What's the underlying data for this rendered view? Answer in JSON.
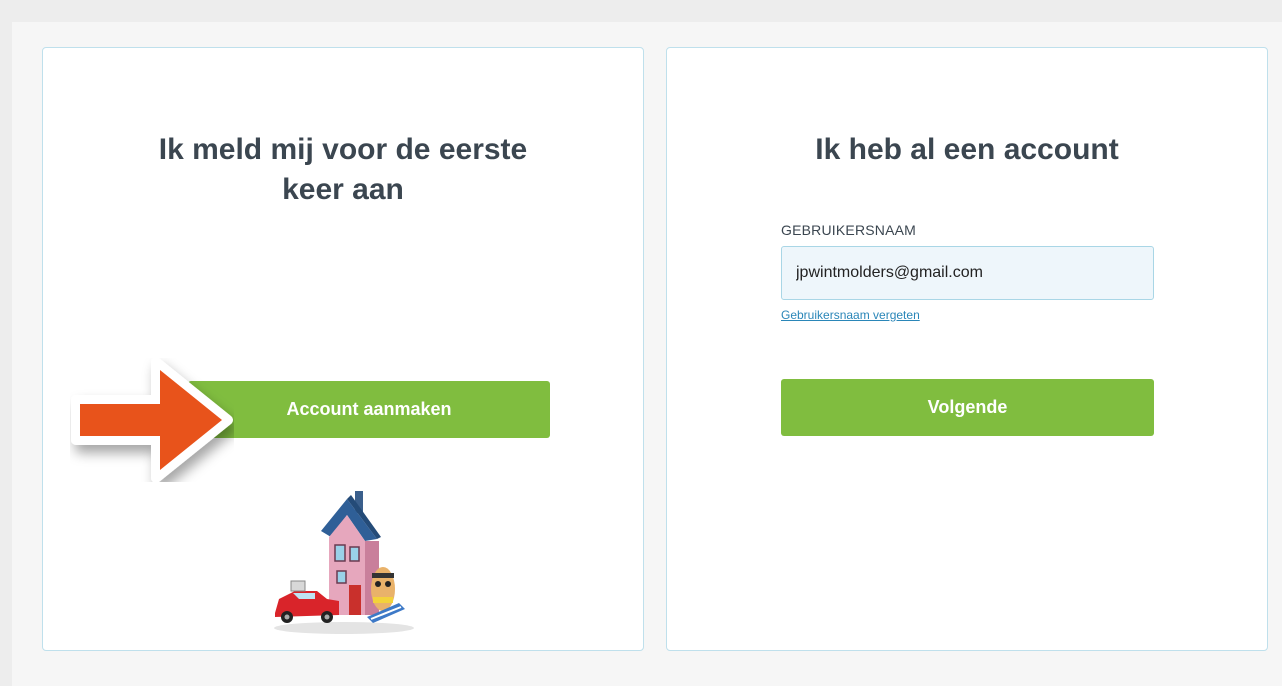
{
  "register": {
    "title": "Ik meld mij voor de eerste keer aan",
    "button_label": "Account aanmaken"
  },
  "login": {
    "title": "Ik heb al een account",
    "username_label": "GEBRUIKERSNAAM",
    "username_value": "jpwintmolders@gmail.com",
    "forgot_username_link": "Gebruikersnaam vergeten",
    "next_button_label": "Volgende"
  },
  "annotation": {
    "arrow_icon": "arrow-right-icon",
    "arrow_color": "#e8531b"
  },
  "colors": {
    "accent_green": "#80bd3f",
    "title_text": "#3b4650",
    "link_blue": "#2a86b8",
    "card_border": "#bfe0ec"
  }
}
